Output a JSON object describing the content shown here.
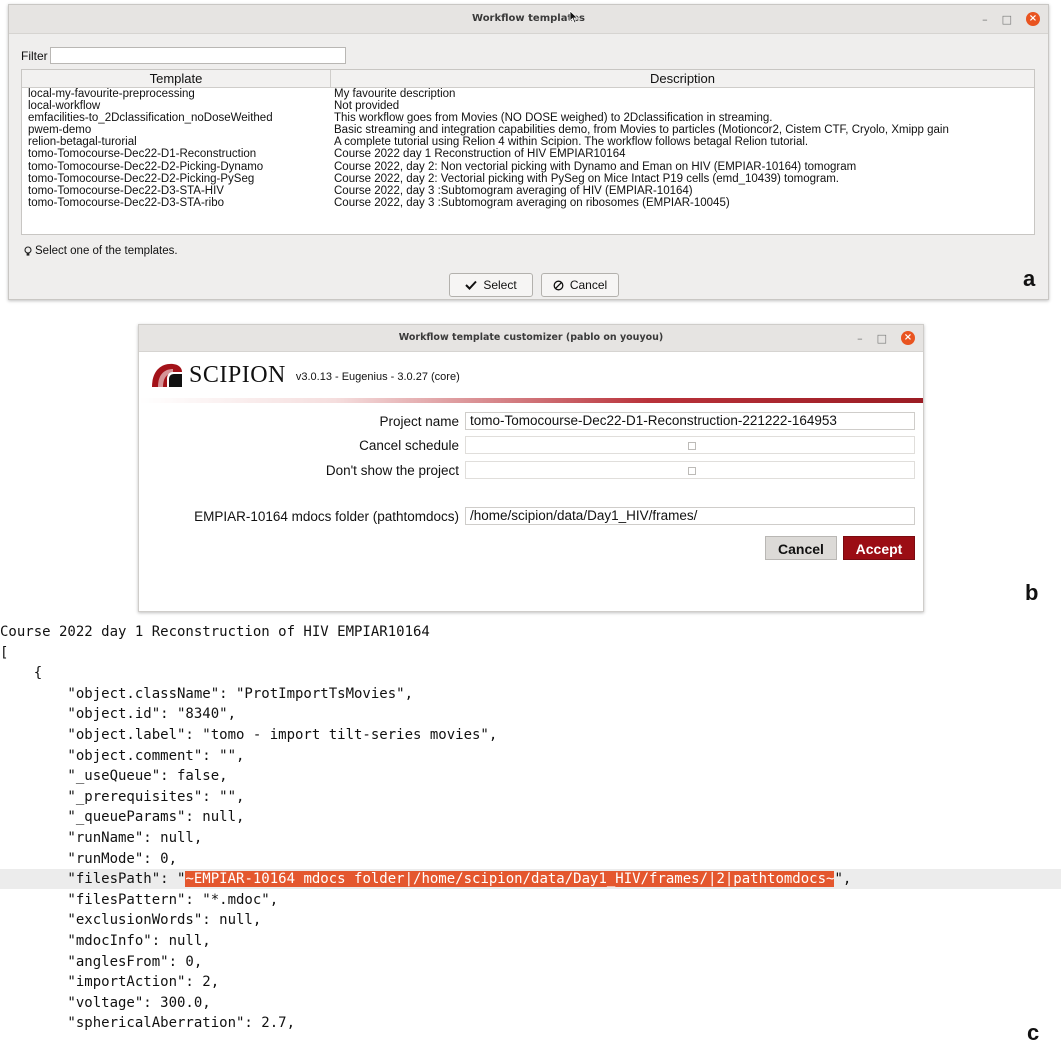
{
  "panel_a": {
    "window_title": "Workflow templates",
    "filter_label": "Filter",
    "filter_value": "",
    "columns": [
      "Template",
      "Description"
    ],
    "rows": [
      {
        "template": "local-my-favourite-preprocessing",
        "description": "My favourite description"
      },
      {
        "template": "local-workflow",
        "description": "Not provided"
      },
      {
        "template": "emfacilities-to_2Dclassification_noDoseWeithed",
        "description": "This workflow goes from Movies (NO DOSE weighed) to 2Dclassification in streaming."
      },
      {
        "template": "pwem-demo",
        "description": "Basic streaming and integration capabilities demo, from Movies to particles (Motioncor2, Cistem CTF, Cryolo, Xmipp gain"
      },
      {
        "template": "relion-betagal-turorial",
        "description": "A complete tutorial using Relion 4 within Scipion. The workflow follows betagal Relion tutorial."
      },
      {
        "template": "tomo-Tomocourse-Dec22-D1-Reconstruction",
        "description": "Course 2022 day 1 Reconstruction of HIV EMPIAR10164"
      },
      {
        "template": "tomo-Tomocourse-Dec22-D2-Picking-Dynamo",
        "description": "Course 2022, day 2: Non vectorial picking with Dynamo and Eman on HIV (EMPIAR-10164) tomogram"
      },
      {
        "template": "tomo-Tomocourse-Dec22-D2-Picking-PySeg",
        "description": "Course 2022, day 2: Vectorial picking with PySeg on Mice Intact P19 cells (emd_10439) tomogram."
      },
      {
        "template": "tomo-Tomocourse-Dec22-D3-STA-HIV",
        "description": "Course 2022, day 3 :Subtomogram averaging of HIV (EMPIAR-10164)"
      },
      {
        "template": "tomo-Tomocourse-Dec22-D3-STA-ribo",
        "description": "Course 2022, day 3 :Subtomogram averaging on ribosomes (EMPIAR-10045)"
      }
    ],
    "hint": "Select one of the templates.",
    "select_label": "Select",
    "cancel_label": "Cancel",
    "panel_letter": "a"
  },
  "panel_b": {
    "window_title": "Workflow template customizer (pablo on youyou)",
    "logo_text": "SCIPION",
    "version": "v3.0.13 - Eugenius - 3.0.27 (core)",
    "project_name_label": "Project name",
    "project_name_value": "tomo-Tomocourse-Dec22-D1-Reconstruction-221222-164953",
    "cancel_schedule_label": "Cancel schedule",
    "dont_show_label": "Don't show the project",
    "mdocs_label": "EMPIAR-10164 mdocs folder (pathtomdocs)",
    "mdocs_value": "/home/scipion/data/Day1_HIV/frames/",
    "cancel_label": "Cancel",
    "accept_label": "Accept",
    "panel_letter": "b",
    "accent_color": "#9b0d14"
  },
  "panel_c": {
    "lines": [
      "Course 2022 day 1 Reconstruction of HIV EMPIAR10164",
      "[",
      "    {",
      "        \"object.className\": \"ProtImportTsMovies\",",
      "        \"object.id\": \"8340\",",
      "        \"object.label\": \"tomo - import tilt-series movies\",",
      "        \"object.comment\": \"\",",
      "        \"_useQueue\": false,",
      "        \"_prerequisites\": \"\",",
      "        \"_queueParams\": null,",
      "        \"runName\": null,",
      "        \"runMode\": 0,",
      "        \"filesPath\": \"",
      "        \"filesPattern\": \"*.mdoc\",",
      "        \"exclusionWords\": null,",
      "        \"mdocInfo\": null,",
      "        \"anglesFrom\": 0,",
      "        \"importAction\": 2,",
      "        \"voltage\": 300.0,",
      "        \"sphericalAberration\": 2.7,"
    ],
    "highlight_text": "~EMPIAR-10164 mdocs folder|/home/scipion/data/Day1_HIV/frames/|2|pathtomdocs~",
    "highlight_suffix": "\",",
    "highlight_color": "#e4572e",
    "panel_letter": "c"
  }
}
